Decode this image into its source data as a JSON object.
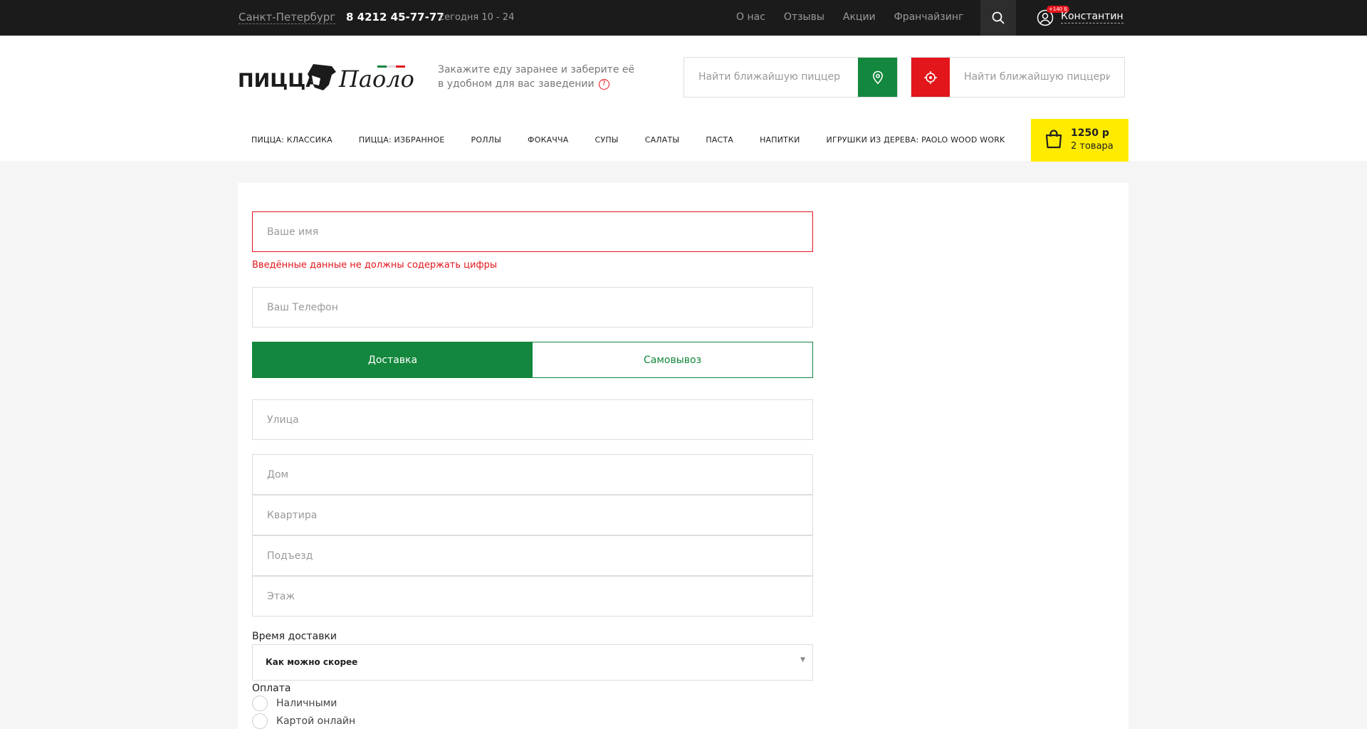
{
  "topbar": {
    "city": "Санкт-Петербург",
    "phone": "8 4212 45-77-77",
    "hours": "сегодня 10 - 24",
    "links": [
      "О нас",
      "Отзывы",
      "Акции",
      "Франчайзинг"
    ],
    "bonus": "+140 Б",
    "user_name": "Константин"
  },
  "header": {
    "logo_text": "ПИЦЦА Паоло",
    "tagline_line1": "Закажите еду заранее и заберите её",
    "tagline_line2": "в удобном для вас заведении",
    "help_glyph": "?",
    "find_placeholder_1": "Найти ближайшую пиццерию",
    "find_placeholder_2": "Найти ближайшую пиццерию"
  },
  "menu": [
    "Пицца: классика",
    "Пицца: избранное",
    "Роллы",
    "Фокачча",
    "Супы",
    "Салаты",
    "Паста",
    "Напитки",
    "Игрушки из дерева: Paolo Wood Work"
  ],
  "cart": {
    "sum": "1250 р",
    "count": "2 товара"
  },
  "form": {
    "name_placeholder": "Ваше имя",
    "name_error": "Введённые данные не должны содержать цифры",
    "phone_placeholder": "Ваш Телефон",
    "delivery_label": "Доставка",
    "pickup_label": "Самовывоз",
    "street_placeholder": "Улица",
    "house_placeholder": "Дом",
    "flat_placeholder": "Квартира",
    "entrance_placeholder": "Подъезд",
    "floor_placeholder": "Этаж",
    "time_label": "Время доставки",
    "time_value": "Как можно скорее",
    "payment_label": "Оплата",
    "pay_cash": "Наличными",
    "pay_card": "Картой онлайн"
  },
  "colors": {
    "green": "#13873d",
    "red": "#e3161c",
    "yellow": "#ffeb00",
    "dark": "#1b1b1b"
  }
}
